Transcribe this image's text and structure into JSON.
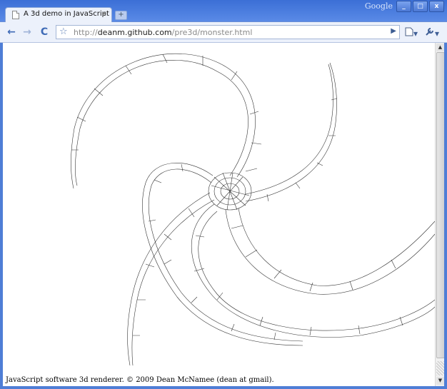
{
  "window": {
    "brand": "Google",
    "controls": {
      "minimize": "_",
      "maximize": "□",
      "close": "x"
    }
  },
  "tab": {
    "title": "A 3d demo in JavaScript",
    "close": "×",
    "new_tab": "+"
  },
  "toolbar": {
    "back": "←",
    "forward": "→",
    "reload": "C",
    "star": "☆",
    "url_scheme": "http://",
    "url_host": "deanm.github.com",
    "url_path": "/pre3d/monster.html",
    "go": "▶",
    "page_menu": "▾",
    "tools_menu": "▾"
  },
  "page": {
    "footer": "JavaScript software 3d renderer. © 2009 Dean McNamee (dean at gmail)."
  },
  "colors": {
    "frame": "#4f7ed6",
    "toolbar": "#ecf1fb",
    "wire": "#333333"
  }
}
